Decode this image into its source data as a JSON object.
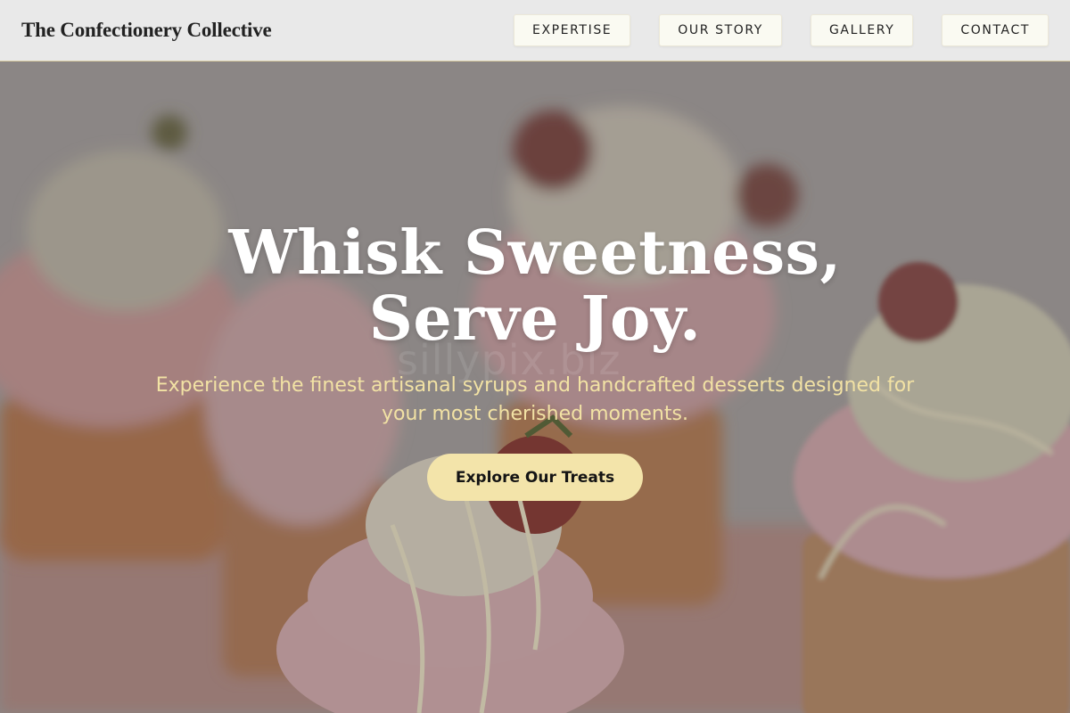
{
  "header": {
    "brand": "The Confectionery Collective",
    "nav": [
      "EXPERTISE",
      "OUR STORY",
      "GALLERY",
      "CONTACT"
    ]
  },
  "hero": {
    "headline": "Whisk Sweetness, Serve Joy.",
    "subtext": "Experience the finest artisanal syrups and handcrafted desserts designed for your most cherished moments.",
    "cta_label": "Explore Our Treats",
    "watermark": "sillypix.biz"
  },
  "colors": {
    "header_bg": "#e9e9e9",
    "nav_button_bg": "#fafaf2",
    "headline": "#ffffff",
    "subtext": "#f2e2a4",
    "cta_bg": "#f3e4aa"
  }
}
